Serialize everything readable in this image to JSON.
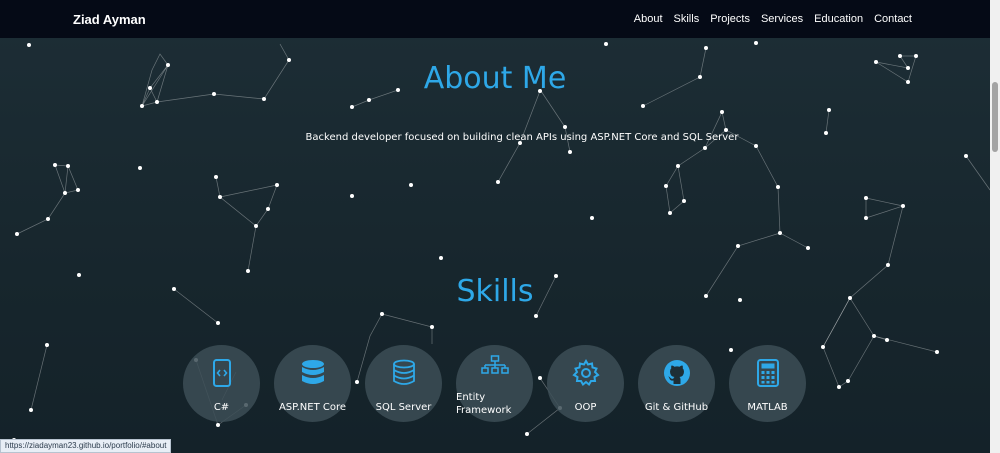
{
  "nav": {
    "brand": "Ziad Ayman",
    "links": [
      "About",
      "Skills",
      "Projects",
      "Services",
      "Education",
      "Contact"
    ]
  },
  "about": {
    "title": "About Me",
    "text": "Backend developer focused on building clean APIs using ASP.NET Core and SQL Server"
  },
  "skills": {
    "title": "Skills",
    "items": [
      {
        "label": "C#",
        "icon": "mobile-code-icon"
      },
      {
        "label": "ASP.NET Core",
        "icon": "database-icon"
      },
      {
        "label": "SQL Server",
        "icon": "database-outline-icon"
      },
      {
        "label": "Entity Framework",
        "icon": "sitemap-icon"
      },
      {
        "label": "OOP",
        "icon": "gear-icon"
      },
      {
        "label": "Git & GitHub",
        "icon": "github-icon"
      },
      {
        "label": "MATLAB",
        "icon": "calculator-icon"
      }
    ]
  },
  "status": {
    "url": "https://ziadayman23.github.io/portfolio/#about"
  },
  "colors": {
    "accent": "#2ea8e8",
    "nav": "#050a16",
    "bg": "#1d2e36"
  }
}
